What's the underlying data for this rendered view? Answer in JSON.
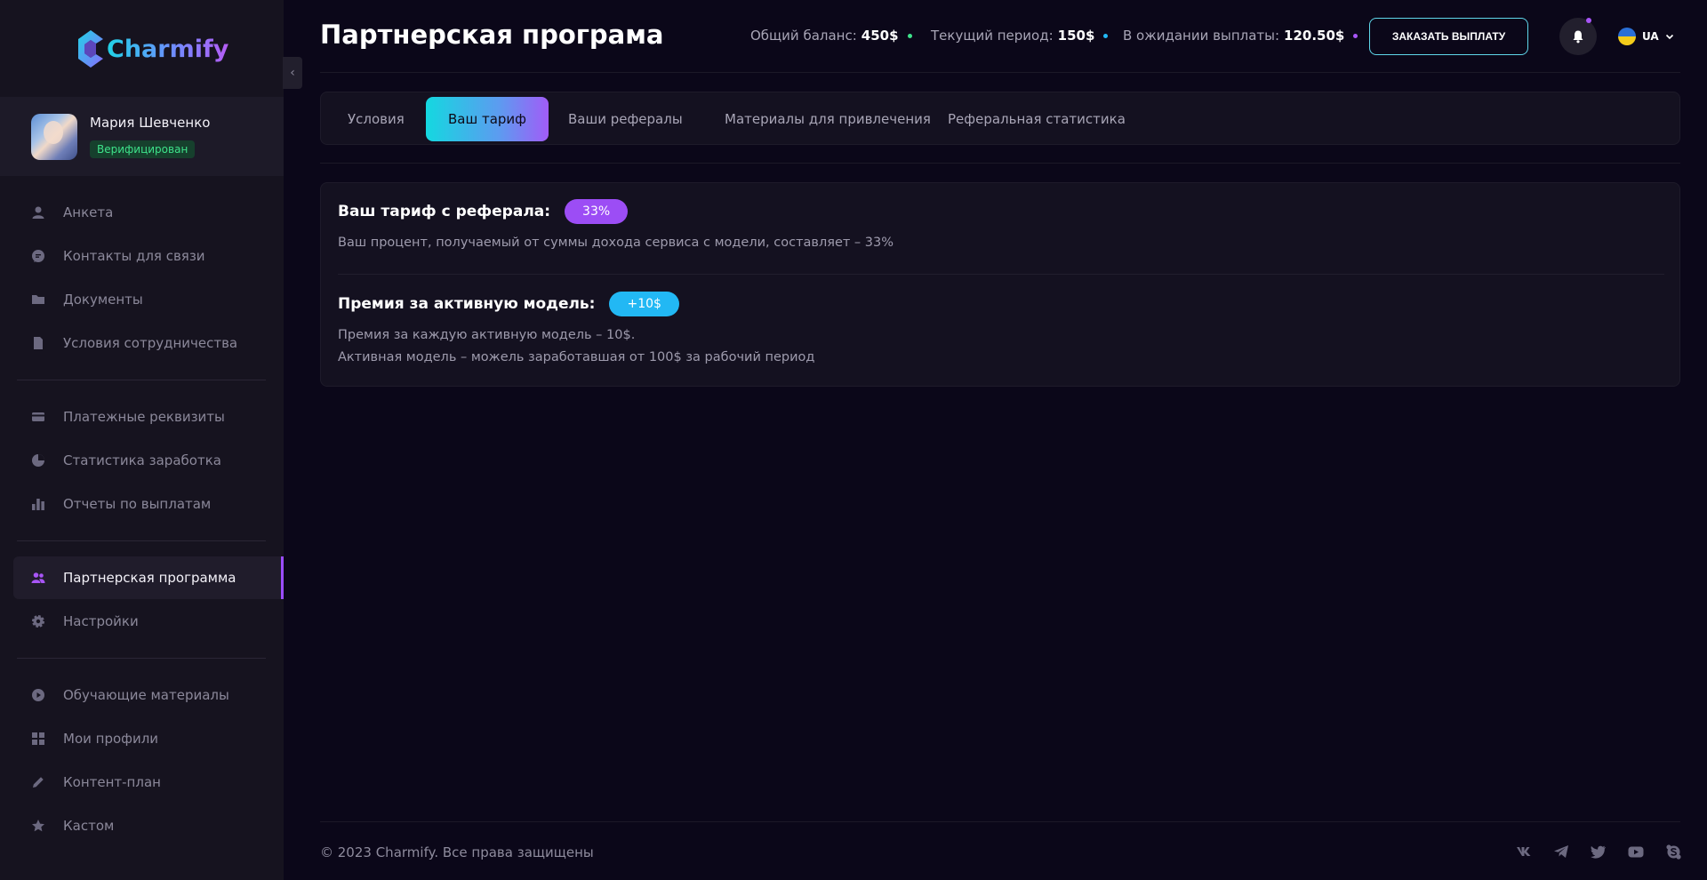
{
  "brand": {
    "name": "Charmify"
  },
  "profile": {
    "name": "Мария Шевченко",
    "badge": "Верифицирован"
  },
  "sidebar": {
    "groups": [
      {
        "items": [
          {
            "label": "Анкета",
            "icon": "user-icon"
          },
          {
            "label": "Контакты для связи",
            "icon": "chat-icon"
          },
          {
            "label": "Документы",
            "icon": "folder-icon"
          },
          {
            "label": "Условия сотрудничества",
            "icon": "file-icon"
          }
        ]
      },
      {
        "items": [
          {
            "label": "Платежные реквизиты",
            "icon": "card-icon"
          },
          {
            "label": "Статистика заработка",
            "icon": "pie-chart-icon"
          },
          {
            "label": "Отчеты по выплатам",
            "icon": "bar-chart-icon"
          }
        ]
      },
      {
        "items": [
          {
            "label": "Партнерская программа",
            "icon": "users-icon",
            "active": true
          },
          {
            "label": "Настройки",
            "icon": "gear-icon"
          }
        ]
      },
      {
        "items": [
          {
            "label": "Обучающие материалы",
            "icon": "play-icon"
          },
          {
            "label": "Мои профили",
            "icon": "grid-icon"
          },
          {
            "label": "Контент-план",
            "icon": "pencil-icon"
          },
          {
            "label": "Кастом",
            "icon": "star-icon"
          }
        ]
      }
    ]
  },
  "header": {
    "title": "Партнерская програма",
    "stats": [
      {
        "label": "Общий баланс:",
        "value": "450$",
        "dot_color": "#3ee28a"
      },
      {
        "label": "Текущий период:",
        "value": "150$",
        "dot_color": "#22b8f4"
      },
      {
        "label": "В ожидании выплаты:",
        "value": "120.50$",
        "dot_color": "#a855f7"
      }
    ],
    "payout_button": "ЗАКАЗАТЬ ВЫПЛАТУ",
    "language": "UA"
  },
  "tabs": [
    {
      "label": "Условия"
    },
    {
      "label": "Ваш тариф",
      "active": true
    },
    {
      "label": "Ваши рефералы"
    },
    {
      "label": "Материалы для привлечения"
    },
    {
      "label": "Реферальная статистика"
    }
  ],
  "tariff": {
    "referral": {
      "title": "Ваш тариф с реферала:",
      "badge": "33%",
      "text": "Ваш процент, получаемый от суммы дохода сервиса с модели, составляет – 33%"
    },
    "bonus": {
      "title": "Премия за активную модель:",
      "badge": "+10$",
      "line1": "Премия за каждую активную модель – 10$.",
      "line2": "Активная модель – можель заработавшая от 100$ за рабочий период"
    }
  },
  "footer": {
    "copyright": "© 2023 Charmify. Все права защищены",
    "socials": [
      "vk-icon",
      "telegram-icon",
      "twitter-icon",
      "youtube-icon",
      "skype-icon"
    ]
  },
  "colors": {
    "accent_purple": "#9b4dff",
    "accent_cyan": "#14d8e0",
    "background": "#0b0719",
    "sidebar": "#16131f"
  }
}
